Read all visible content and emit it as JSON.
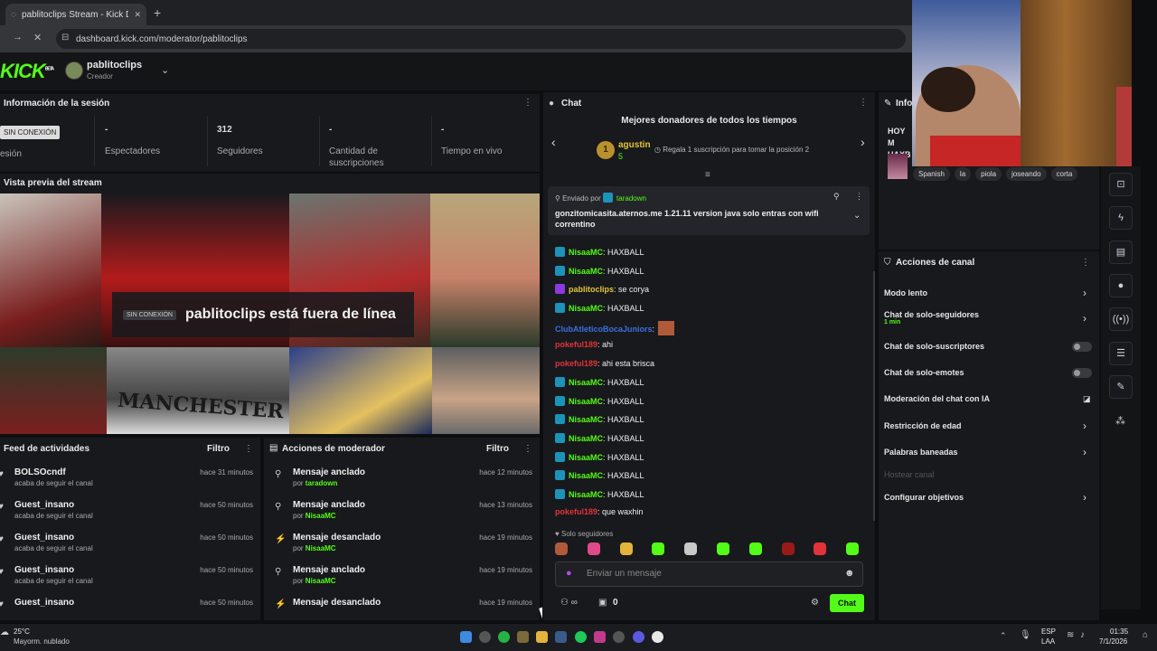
{
  "browser": {
    "tab_title": "pablitoclips Stream - Kick Dashb",
    "close": "✕",
    "new_tab": "+",
    "url": "dashboard.kick.com/moderator/pablitoclips"
  },
  "header": {
    "logo": "KICK",
    "logo_beta": "BETA",
    "channel_name": "pablitoclips",
    "channel_role": "Creador"
  },
  "session": {
    "title": "Información de la sesión",
    "status_badge": "SIN CONEXIÓN",
    "status_label": "esión",
    "stats": [
      {
        "value": "-",
        "label": "Espectadores"
      },
      {
        "value": "312",
        "label": "Seguidores"
      },
      {
        "value": "-",
        "label": "Cantidad de suscripciones"
      },
      {
        "value": "-",
        "label": "Tiempo en vivo"
      }
    ]
  },
  "preview": {
    "title": "Vista previa del stream",
    "offline_tag": "SIN CONEXIÓN",
    "offline_text": "pablitoclips está fuera de línea",
    "banner_text": "MANCHESTER"
  },
  "feed": {
    "title": "Feed de actividades",
    "filter": "Filtro",
    "items": [
      {
        "name": "BOLSOcndf",
        "sub": "acaba de seguir el canal",
        "time": "hace 31 minutos"
      },
      {
        "name": "Guest_insano",
        "sub": "acaba de seguir el canal",
        "time": "hace 50 minutos"
      },
      {
        "name": "Guest_insano",
        "sub": "acaba de seguir el canal",
        "time": "hace 50 minutos"
      },
      {
        "name": "Guest_insano",
        "sub": "acaba de seguir el canal",
        "time": "hace 50 minutos"
      },
      {
        "name": "Guest_insano",
        "sub": "",
        "time": "hace 50 minutos"
      }
    ]
  },
  "modactions": {
    "title": "Acciones de moderador",
    "filter": "Filtro",
    "items": [
      {
        "action": "Mensaje anclado",
        "by": "por",
        "user": "taradown",
        "time": "hace 12 minutos"
      },
      {
        "action": "Mensaje anclado",
        "by": "por",
        "user": "NisaaMC",
        "time": "hace 13 minutos"
      },
      {
        "action": "Mensaje desanclado",
        "by": "por",
        "user": "NisaaMC",
        "time": "hace 19 minutos"
      },
      {
        "action": "Mensaje anclado",
        "by": "por",
        "user": "NisaaMC",
        "time": "hace 19 minutos"
      },
      {
        "action": "Mensaje desanclado",
        "by": "",
        "user": "",
        "time": "hace 19 minutos"
      }
    ]
  },
  "chat": {
    "title": "Chat",
    "donors_title": "Mejores donadores de todos los tiempos",
    "top_donor": "agustin",
    "top_donor_count": "5",
    "donor_rank": "1",
    "donor_prompt": "Regala 1 suscripción para tomar la posición 2",
    "pinned_by_label": "Enviado por",
    "pinned_by_user": "taradown",
    "pinned_text": "gonzitomicasita.aternos.me 1.21.11 version java solo entras con wifi correntino",
    "messages": [
      {
        "user": "NisaaMC",
        "text": ": HAXBALL",
        "color": "#53fc18",
        "badge": true
      },
      {
        "user": "NisaaMC",
        "text": ": HAXBALL",
        "color": "#53fc18",
        "badge": true
      },
      {
        "user": "pablitoclips",
        "text": ": se corya",
        "color": "#e3c53a",
        "badge": true
      },
      {
        "user": "NisaaMC",
        "text": ": HAXBALL",
        "color": "#53fc18",
        "badge": true
      },
      {
        "user": "ClubAtleticoBocaJuniors",
        "text": ":",
        "color": "#3b6fe0",
        "badge": false
      },
      {
        "user": "pokeful189",
        "text": ": ahi",
        "color": "#e0343a",
        "badge": false
      },
      {
        "user": "pokeful189",
        "text": ": ahi esta brisca",
        "color": "#e0343a",
        "badge": false
      },
      {
        "user": "NisaaMC",
        "text": ": HAXBALL",
        "color": "#53fc18",
        "badge": true
      },
      {
        "user": "NisaaMC",
        "text": ": HAXBALL",
        "color": "#53fc18",
        "badge": true
      },
      {
        "user": "NisaaMC",
        "text": ": HAXBALL",
        "color": "#53fc18",
        "badge": true
      },
      {
        "user": "NisaaMC",
        "text": ": HAXBALL",
        "color": "#53fc18",
        "badge": true
      },
      {
        "user": "NisaaMC",
        "text": ": HAXBALL",
        "color": "#53fc18",
        "badge": true
      },
      {
        "user": "NisaaMC",
        "text": ": HAXBALL",
        "color": "#53fc18",
        "badge": true
      },
      {
        "user": "NisaaMC",
        "text": ": HAXBALL",
        "color": "#53fc18",
        "badge": true
      },
      {
        "user": "pokeful189",
        "text": ": que waxhin",
        "color": "#e0343a",
        "badge": false
      }
    ],
    "followers_only": "Solo seguidores",
    "input_placeholder": "Enviar un mensaje",
    "count": "0",
    "send_button": "Chat"
  },
  "info": {
    "title": "Info",
    "stream_title": "HOY M HAXB",
    "tags": [
      "Spanish",
      "la",
      "piola",
      "joseando",
      "corta"
    ]
  },
  "channel_actions": {
    "title": "Acciones de canal",
    "items": [
      {
        "label": "Modo lento",
        "sub": "",
        "control": "chevron"
      },
      {
        "label": "Chat de solo-seguidores",
        "sub": "1 min",
        "control": "chevron"
      },
      {
        "label": "Chat de solo-suscriptores",
        "sub": "",
        "control": "toggle"
      },
      {
        "label": "Chat de solo-emotes",
        "sub": "",
        "control": "toggle"
      },
      {
        "label": "Moderación del chat con IA",
        "sub": "",
        "control": "chart"
      },
      {
        "label": "Restricción de edad",
        "sub": "",
        "control": "chevron"
      },
      {
        "label": "Palabras baneadas",
        "sub": "",
        "control": "chevron"
      },
      {
        "label": "Hostear canal",
        "sub": "",
        "control": "disabled"
      },
      {
        "label": "Configurar objetivos",
        "sub": "",
        "control": "chevron"
      }
    ]
  },
  "taskbar": {
    "weather_temp": "25°C",
    "weather_desc": "Mayorm. nublado",
    "lang": "ESP",
    "lang_sub": "LAA",
    "time": "01:35",
    "date": "7/1/2026"
  },
  "colors": {
    "accent": "#53fc18",
    "panel": "#18191c",
    "background": "#0d0e10"
  }
}
